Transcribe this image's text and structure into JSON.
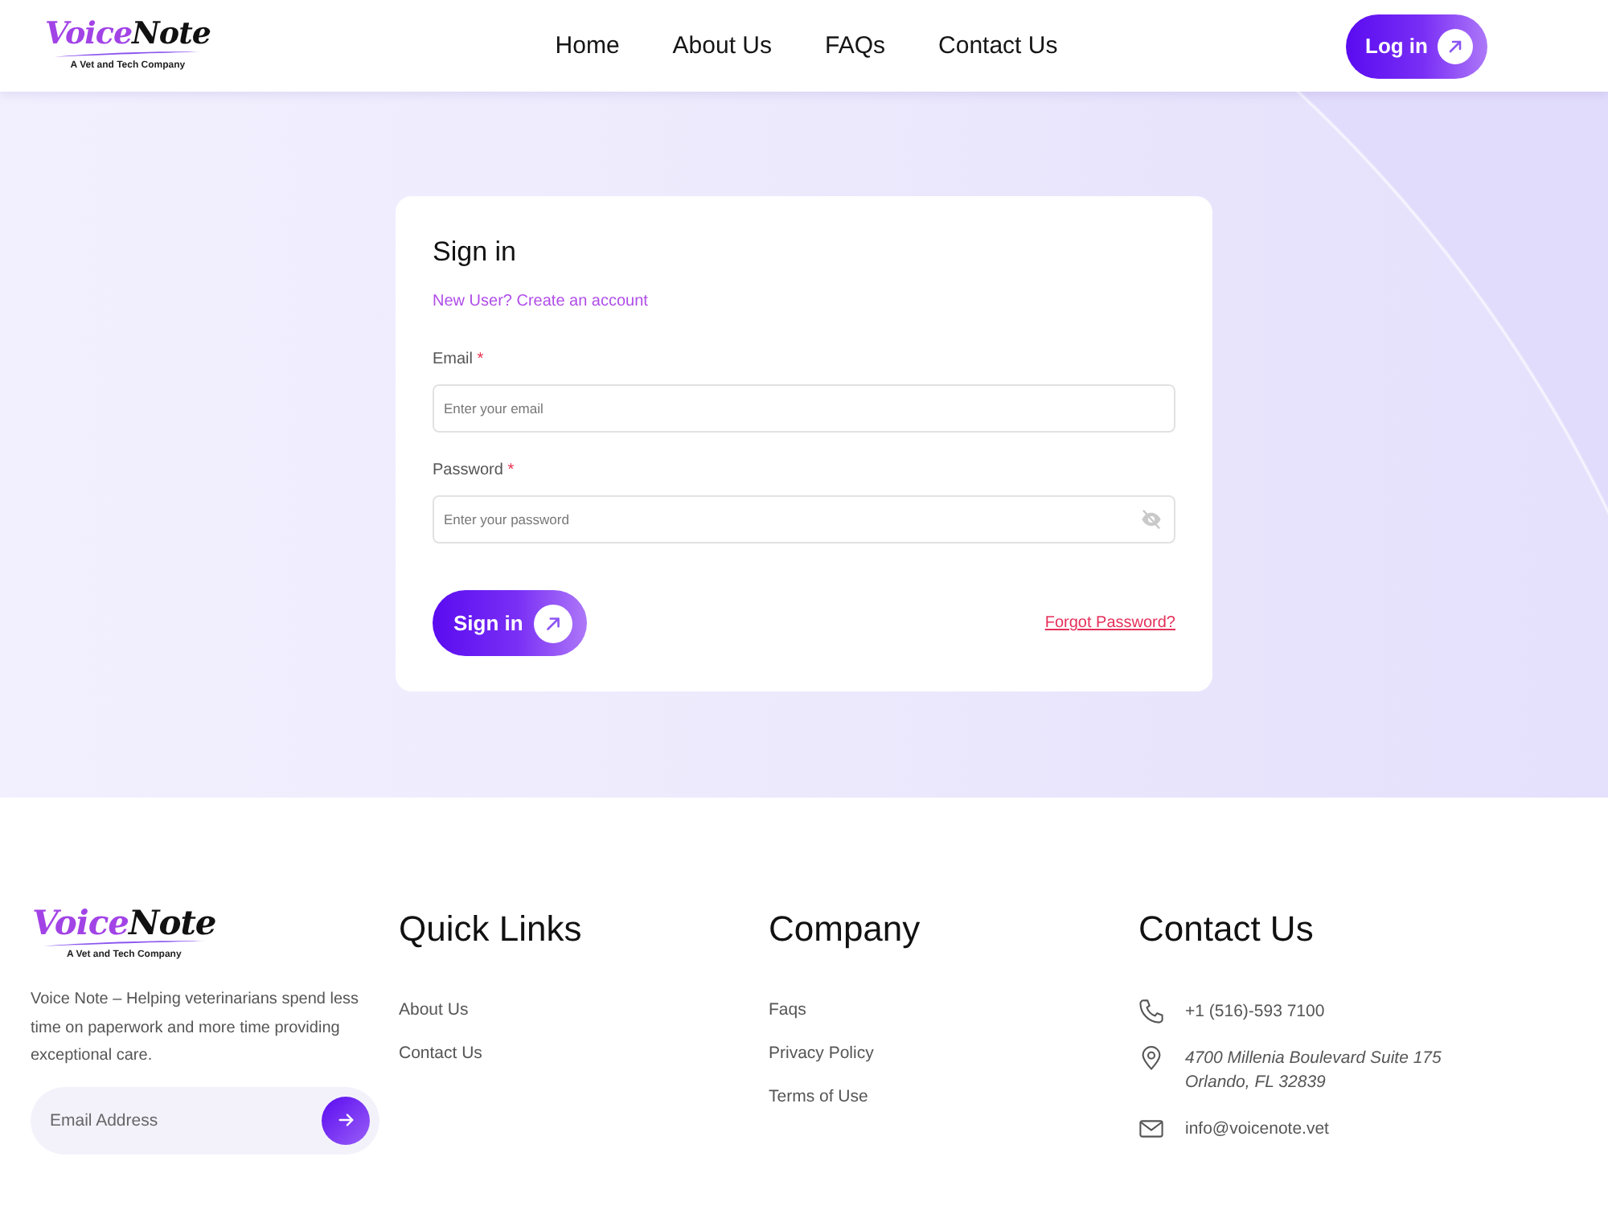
{
  "header": {
    "logo": {
      "wordmark": [
        "Voice",
        "Note"
      ],
      "tagline": "A Vet and Tech Company"
    },
    "nav": [
      "Home",
      "About Us",
      "FAQs",
      "Contact Us"
    ],
    "login_button": "Log in"
  },
  "signin_form": {
    "title": "Sign in",
    "signup_link": "New User? Create an account",
    "fields": [
      {
        "kind": "email",
        "label": "Email",
        "required_mark": "*",
        "placeholder": "Enter your email"
      },
      {
        "kind": "password",
        "label": "Password",
        "required_mark": "*",
        "placeholder": "Enter your password"
      }
    ],
    "submit_button": "Sign in",
    "forgot_link": "Forgot Password?"
  },
  "footer": {
    "logo": {
      "wordmark": [
        "Voice",
        "Note"
      ],
      "tagline": "A Vet and Tech Company"
    },
    "description": "Voice Note – Helping veterinarians spend less time on paperwork and more time providing exceptional care.",
    "newsletter": {
      "placeholder": "Email Address"
    },
    "columns": [
      {
        "title": "Quick Links",
        "links": [
          "About Us",
          "Contact Us"
        ]
      },
      {
        "title": "Company",
        "links": [
          "Faqs",
          "Privacy Policy",
          "Terms of Use"
        ]
      }
    ],
    "contact": {
      "title": "Contact Us",
      "items": [
        {
          "kind": "phone",
          "text": "+1 (516)-593 7100"
        },
        {
          "kind": "address",
          "text": "4700 Millenia Boulevard Suite 175\nOrlando, FL 32839"
        },
        {
          "kind": "email",
          "text": "info@voicenote.vet"
        }
      ]
    }
  }
}
